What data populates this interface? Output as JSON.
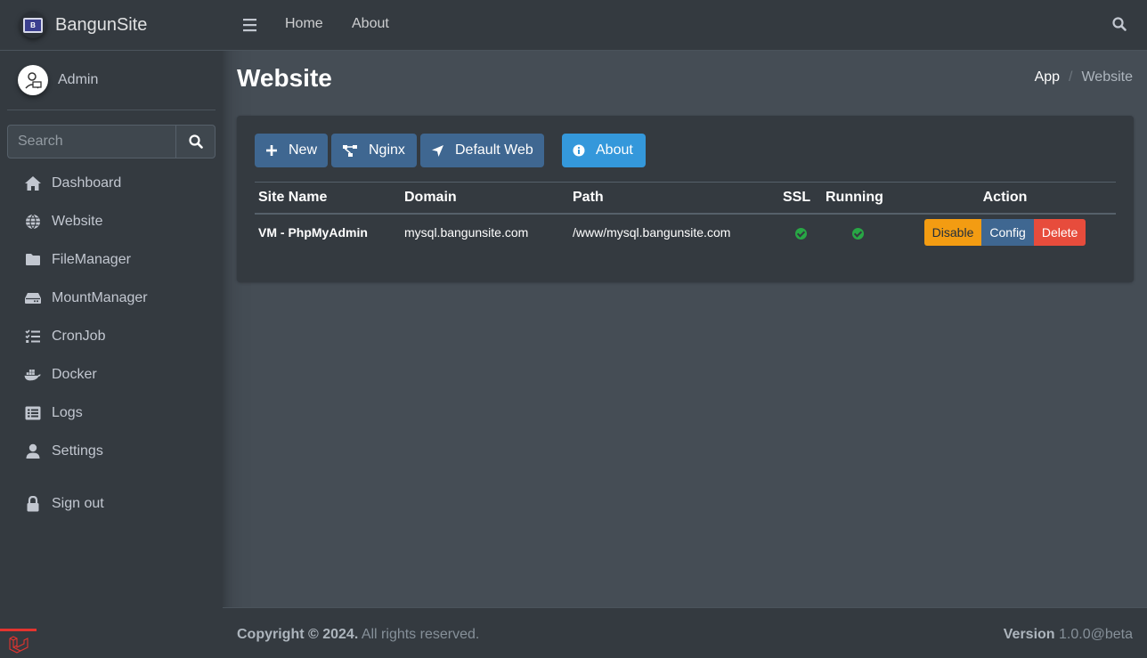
{
  "brand": {
    "name": "BangunSite",
    "logo_letter": "B"
  },
  "user": {
    "name": "Admin"
  },
  "sidebar": {
    "search_placeholder": "Search",
    "items": [
      {
        "label": "Dashboard",
        "icon": "home-icon"
      },
      {
        "label": "Website",
        "icon": "globe-icon"
      },
      {
        "label": "FileManager",
        "icon": "folder-icon"
      },
      {
        "label": "MountManager",
        "icon": "hdd-icon"
      },
      {
        "label": "CronJob",
        "icon": "tasks-icon"
      },
      {
        "label": "Docker",
        "icon": "docker-icon"
      },
      {
        "label": "Logs",
        "icon": "list-alt-icon"
      },
      {
        "label": "Settings",
        "icon": "user-icon"
      },
      {
        "label": "Sign out",
        "icon": "lock-icon"
      }
    ]
  },
  "topnav": {
    "home": "Home",
    "about": "About"
  },
  "page": {
    "title": "Website"
  },
  "breadcrumb": {
    "root": "App",
    "separator": "/",
    "current": "Website"
  },
  "toolbar": {
    "new": "New",
    "nginx": "Nginx",
    "default_web": "Default Web",
    "about": "About"
  },
  "table": {
    "headers": [
      "Site Name",
      "Domain",
      "Path",
      "SSL",
      "Running",
      "Action"
    ],
    "rows": [
      {
        "site_name": "VM - PhpMyAdmin",
        "domain": "mysql.bangunsite.com",
        "path": "/www/mysql.bangunsite.com",
        "ssl": true,
        "running": true
      }
    ],
    "actions": {
      "disable": "Disable",
      "config": "Config",
      "delete": "Delete"
    }
  },
  "footer": {
    "copyright": "Copyright © 2024.",
    "rights": "All rights reserved.",
    "version_label": "Version",
    "version": "1.0.0@beta"
  },
  "colors": {
    "primary": "#3f6791",
    "info": "#3498db",
    "warning": "#f39c12",
    "danger": "#e74c3c",
    "success": "#28a745",
    "laravel": "#e3342f"
  }
}
